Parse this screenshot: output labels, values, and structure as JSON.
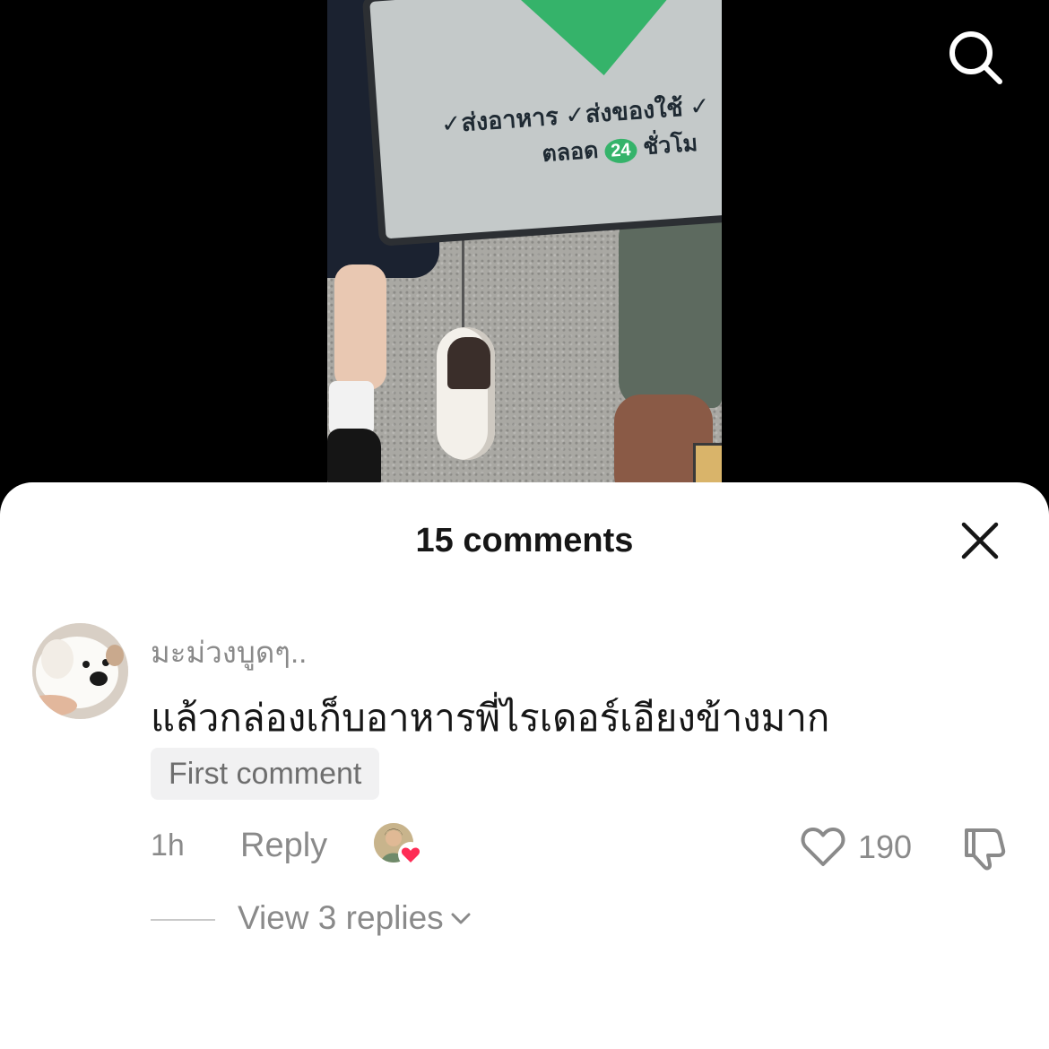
{
  "video": {
    "box_line1": "✓ส่งอาหาร ✓ส่งของใช้ ✓",
    "box_line2_prefix": "ตลอด",
    "box_badge": "24",
    "box_line2_suffix": "ชั่วโม"
  },
  "header": {
    "search_icon": "search-icon"
  },
  "comments_sheet": {
    "title": "15 comments",
    "close_icon": "close-icon",
    "comment": {
      "username": "มะม่วงบูดๆ..",
      "text": "แล้วกล่องเก็บอาหารพี่ไรเดอร์เอียงข้างมาก",
      "badge": "First comment",
      "time": "1h",
      "reply_label": "Reply",
      "creator_liked": true,
      "like_count": "190",
      "view_replies_label": "View 3 replies"
    }
  },
  "colors": {
    "heart": "#fe2c55",
    "muted_text": "#8a8a8a",
    "primary_text": "#161616",
    "badge_bg": "#f1f1f2"
  }
}
